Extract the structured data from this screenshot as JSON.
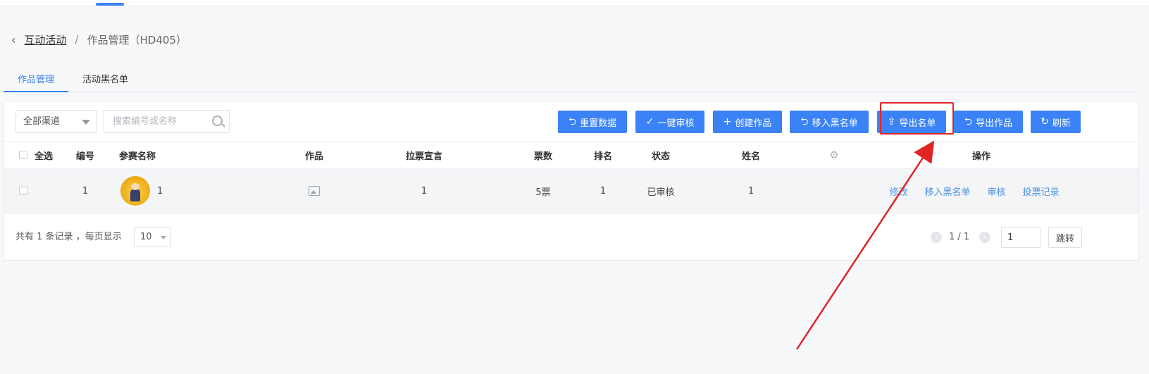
{
  "breadcrumb": {
    "back_icon": "‹",
    "parent": "互动活动",
    "separator": "/",
    "current": "作品管理（HD405）"
  },
  "tabs": [
    {
      "label": "作品管理",
      "active": true
    },
    {
      "label": "活动黑名单",
      "active": false
    }
  ],
  "filters": {
    "channel_select": "全部渠道",
    "search_placeholder": "搜索编号或名称"
  },
  "toolbar": {
    "buttons": [
      {
        "label": "重置数据",
        "icon": "undo-icon"
      },
      {
        "label": "一键审核",
        "icon": "check-circle-icon"
      },
      {
        "label": "创建作品",
        "icon": "plus-icon"
      },
      {
        "label": "移入黑名单",
        "icon": "undo-icon"
      },
      {
        "label": "导出名单",
        "icon": "upload-icon"
      },
      {
        "label": "导出作品",
        "icon": "undo-icon"
      },
      {
        "label": "刷新",
        "icon": "refresh-icon"
      }
    ],
    "highlighted_button": "导出名单",
    "accent_color": "#3a82f6",
    "highlight_color": "#e02424"
  },
  "table": {
    "columns": {
      "select_all": "全选",
      "number": "编号",
      "contestant_name": "参赛名称",
      "work": "作品",
      "slogan": "拉票宣言",
      "votes": "票数",
      "rank": "排名",
      "status": "状态",
      "name": "姓名",
      "settings_icon": "gear-icon",
      "actions": "操作"
    },
    "rows": [
      {
        "number": "1",
        "contestant_name": "1",
        "work_icon": "image-icon",
        "slogan": "1",
        "votes": "5票",
        "rank": "1",
        "status": "已审核",
        "name": "1",
        "actions": [
          "修改",
          "移入黑名单",
          "审核",
          "投票记录"
        ]
      }
    ]
  },
  "footer": {
    "total_text": "共有 1 条记录 ，每页显示",
    "page_size": "10",
    "page_indicator": "1 / 1",
    "jump_value": "1",
    "jump_button": "跳转"
  }
}
